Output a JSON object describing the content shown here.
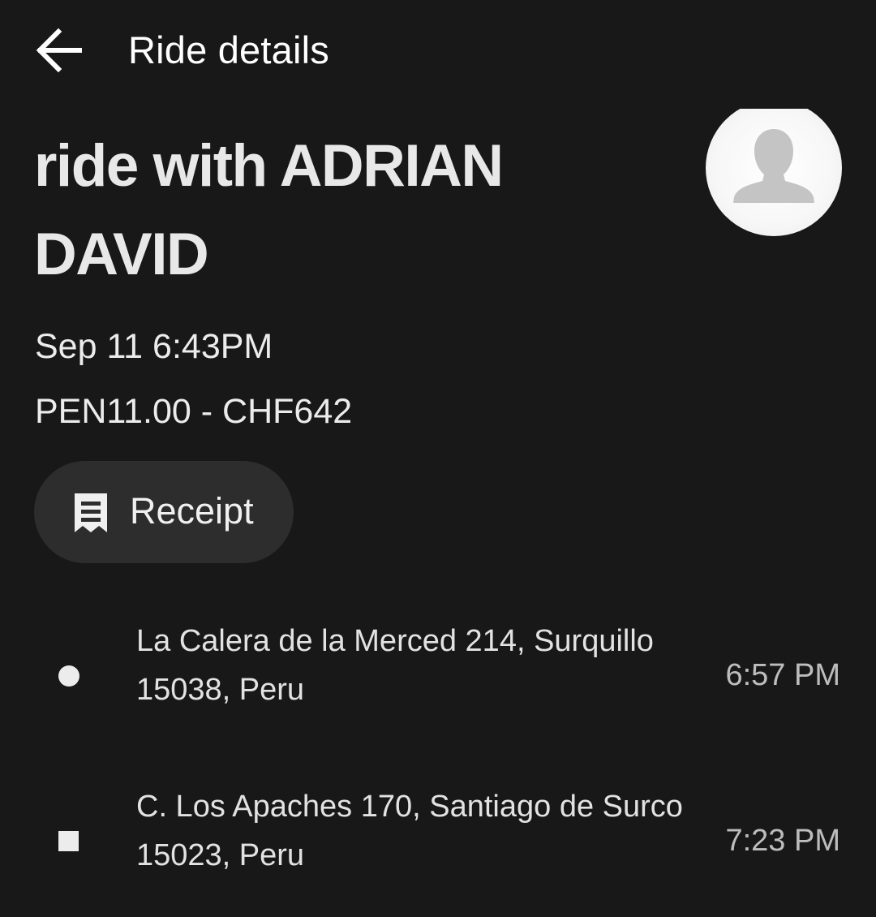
{
  "app_bar": {
    "back_icon": "arrow-left-icon",
    "title": "Ride details"
  },
  "ride": {
    "heading": "ride with ADRIAN DAVID",
    "date_time": "Sep 11 6:43PM",
    "fare": "PEN11.00 - CHF642",
    "avatar_icon": "person-silhouette-icon"
  },
  "receipt_button": {
    "icon": "receipt-icon",
    "label": "Receipt"
  },
  "stops": [
    {
      "marker": "circle",
      "address": "La Calera de la Merced 214, Surquillo 15038, Peru",
      "time": "6:57 PM"
    },
    {
      "marker": "square",
      "address": "C. Los Apaches 170, Santiago de Surco 15023, Peru",
      "time": "7:23 PM"
    }
  ],
  "colors": {
    "background": "#181818",
    "button_background": "#2d2d2d",
    "text_primary": "#ffffff",
    "text_secondary": "#bdbdbd"
  }
}
